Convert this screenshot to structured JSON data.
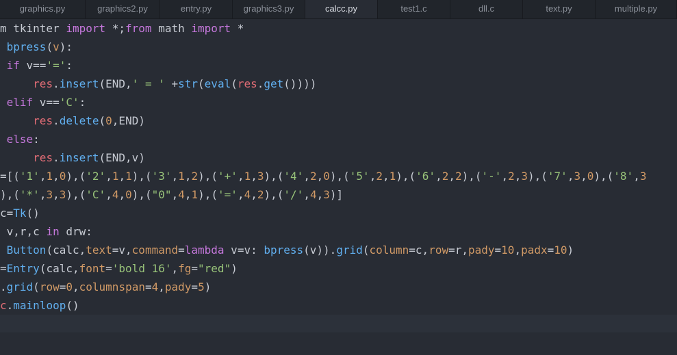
{
  "tabs": [
    {
      "label": "graphics.py",
      "active": false
    },
    {
      "label": "graphics2.py",
      "active": false
    },
    {
      "label": "entry.py",
      "active": false
    },
    {
      "label": "graphics3.py",
      "active": false
    },
    {
      "label": "calcc.py",
      "active": true
    },
    {
      "label": "test1.c",
      "active": false
    },
    {
      "label": "dll.c",
      "active": false
    },
    {
      "label": "text.py",
      "active": false
    },
    {
      "label": "multiple.py",
      "active": false
    }
  ],
  "colors": {
    "background": "#282c34",
    "keyword": "#c678dd",
    "function": "#61afef",
    "string": "#98c379",
    "number": "#d19a66",
    "variable": "#e06c75",
    "plain": "#c8ccd4"
  },
  "code": [
    [
      [
        "m tkinter ",
        "pl"
      ],
      [
        "import",
        "kw"
      ],
      [
        " *;",
        "pl"
      ],
      [
        "from",
        "kw"
      ],
      [
        " math ",
        "pl"
      ],
      [
        "import",
        "kw"
      ],
      [
        " *",
        "pl"
      ]
    ],
    [
      [
        " ",
        "pl"
      ],
      [
        "bpress",
        "fn"
      ],
      [
        "(",
        "pl"
      ],
      [
        "v",
        "num"
      ],
      [
        "):",
        "pl"
      ]
    ],
    [
      [
        " ",
        "pl"
      ],
      [
        "if",
        "kw"
      ],
      [
        " v==",
        "pl"
      ],
      [
        "'='",
        "str"
      ],
      [
        ":",
        "pl"
      ]
    ],
    [
      [
        "     ",
        "pl"
      ],
      [
        "res",
        "var"
      ],
      [
        ".",
        "pl"
      ],
      [
        "insert",
        "fn"
      ],
      [
        "(END,",
        "pl"
      ],
      [
        "' = '",
        "str"
      ],
      [
        " +",
        "pl"
      ],
      [
        "str",
        "fn"
      ],
      [
        "(",
        "pl"
      ],
      [
        "eval",
        "fn"
      ],
      [
        "(",
        "pl"
      ],
      [
        "res",
        "var"
      ],
      [
        ".",
        "pl"
      ],
      [
        "get",
        "fn"
      ],
      [
        "())))",
        "pl"
      ]
    ],
    [
      [
        " ",
        "pl"
      ],
      [
        "elif",
        "kw"
      ],
      [
        " v==",
        "pl"
      ],
      [
        "'C'",
        "str"
      ],
      [
        ":",
        "pl"
      ]
    ],
    [
      [
        "     ",
        "pl"
      ],
      [
        "res",
        "var"
      ],
      [
        ".",
        "pl"
      ],
      [
        "delete",
        "fn"
      ],
      [
        "(",
        "pl"
      ],
      [
        "0",
        "num"
      ],
      [
        ",END)",
        "pl"
      ]
    ],
    [
      [
        " ",
        "pl"
      ],
      [
        "else",
        "kw"
      ],
      [
        ":",
        "pl"
      ]
    ],
    [
      [
        "     ",
        "pl"
      ],
      [
        "res",
        "var"
      ],
      [
        ".",
        "pl"
      ],
      [
        "insert",
        "fn"
      ],
      [
        "(END,v)",
        "pl"
      ]
    ],
    [
      [
        "=[(",
        "pl"
      ],
      [
        "'1'",
        "str"
      ],
      [
        ",",
        "pl"
      ],
      [
        "1",
        "num"
      ],
      [
        ",",
        "pl"
      ],
      [
        "0",
        "num"
      ],
      [
        "),(",
        "pl"
      ],
      [
        "'2'",
        "str"
      ],
      [
        ",",
        "pl"
      ],
      [
        "1",
        "num"
      ],
      [
        ",",
        "pl"
      ],
      [
        "1",
        "num"
      ],
      [
        "),(",
        "pl"
      ],
      [
        "'3'",
        "str"
      ],
      [
        ",",
        "pl"
      ],
      [
        "1",
        "num"
      ],
      [
        ",",
        "pl"
      ],
      [
        "2",
        "num"
      ],
      [
        "),(",
        "pl"
      ],
      [
        "'+'",
        "str"
      ],
      [
        ",",
        "pl"
      ],
      [
        "1",
        "num"
      ],
      [
        ",",
        "pl"
      ],
      [
        "3",
        "num"
      ],
      [
        "),(",
        "pl"
      ],
      [
        "'4'",
        "str"
      ],
      [
        ",",
        "pl"
      ],
      [
        "2",
        "num"
      ],
      [
        ",",
        "pl"
      ],
      [
        "0",
        "num"
      ],
      [
        "),(",
        "pl"
      ],
      [
        "'5'",
        "str"
      ],
      [
        ",",
        "pl"
      ],
      [
        "2",
        "num"
      ],
      [
        ",",
        "pl"
      ],
      [
        "1",
        "num"
      ],
      [
        "),(",
        "pl"
      ],
      [
        "'6'",
        "str"
      ],
      [
        ",",
        "pl"
      ],
      [
        "2",
        "num"
      ],
      [
        ",",
        "pl"
      ],
      [
        "2",
        "num"
      ],
      [
        "),(",
        "pl"
      ],
      [
        "'-'",
        "str"
      ],
      [
        ",",
        "pl"
      ],
      [
        "2",
        "num"
      ],
      [
        ",",
        "pl"
      ],
      [
        "3",
        "num"
      ],
      [
        "),(",
        "pl"
      ],
      [
        "'7'",
        "str"
      ],
      [
        ",",
        "pl"
      ],
      [
        "3",
        "num"
      ],
      [
        ",",
        "pl"
      ],
      [
        "0",
        "num"
      ],
      [
        "),(",
        "pl"
      ],
      [
        "'8'",
        "str"
      ],
      [
        ",",
        "pl"
      ],
      [
        "3",
        "num"
      ]
    ],
    [
      [
        "),(",
        "pl"
      ],
      [
        "'*'",
        "str"
      ],
      [
        ",",
        "pl"
      ],
      [
        "3",
        "num"
      ],
      [
        ",",
        "pl"
      ],
      [
        "3",
        "num"
      ],
      [
        "),(",
        "pl"
      ],
      [
        "'C'",
        "str"
      ],
      [
        ",",
        "pl"
      ],
      [
        "4",
        "num"
      ],
      [
        ",",
        "pl"
      ],
      [
        "0",
        "num"
      ],
      [
        "),(",
        "pl"
      ],
      [
        "\"0\"",
        "str"
      ],
      [
        ",",
        "pl"
      ],
      [
        "4",
        "num"
      ],
      [
        ",",
        "pl"
      ],
      [
        "1",
        "num"
      ],
      [
        "),(",
        "pl"
      ],
      [
        "'='",
        "str"
      ],
      [
        ",",
        "pl"
      ],
      [
        "4",
        "num"
      ],
      [
        ",",
        "pl"
      ],
      [
        "2",
        "num"
      ],
      [
        "),(",
        "pl"
      ],
      [
        "'/'",
        "str"
      ],
      [
        ",",
        "pl"
      ],
      [
        "4",
        "num"
      ],
      [
        ",",
        "pl"
      ],
      [
        "3",
        "num"
      ],
      [
        ")]",
        "pl"
      ]
    ],
    [
      [
        "c=",
        "pl"
      ],
      [
        "Tk",
        "fn"
      ],
      [
        "()",
        "pl"
      ]
    ],
    [
      [
        " v,r,c ",
        "pl"
      ],
      [
        "in",
        "kw"
      ],
      [
        " drw:",
        "pl"
      ]
    ],
    [
      [
        " ",
        "pl"
      ],
      [
        "Button",
        "fn"
      ],
      [
        "(calc,",
        "pl"
      ],
      [
        "text",
        "num"
      ],
      [
        "=v,",
        "pl"
      ],
      [
        "command",
        "num"
      ],
      [
        "=",
        "pl"
      ],
      [
        "lambda",
        "kw"
      ],
      [
        " v=v: ",
        "pl"
      ],
      [
        "bpress",
        "fn"
      ],
      [
        "(v)).",
        "pl"
      ],
      [
        "grid",
        "fn"
      ],
      [
        "(",
        "pl"
      ],
      [
        "column",
        "num"
      ],
      [
        "=c,",
        "pl"
      ],
      [
        "row",
        "num"
      ],
      [
        "=r,",
        "pl"
      ],
      [
        "pady",
        "num"
      ],
      [
        "=",
        "pl"
      ],
      [
        "10",
        "num"
      ],
      [
        ",",
        "pl"
      ],
      [
        "padx",
        "num"
      ],
      [
        "=",
        "pl"
      ],
      [
        "10",
        "num"
      ],
      [
        ")",
        "pl"
      ]
    ],
    [
      [
        "=",
        "pl"
      ],
      [
        "Entry",
        "fn"
      ],
      [
        "(calc,",
        "pl"
      ],
      [
        "font",
        "num"
      ],
      [
        "=",
        "pl"
      ],
      [
        "'bold 16'",
        "str"
      ],
      [
        ",",
        "pl"
      ],
      [
        "fg",
        "num"
      ],
      [
        "=",
        "pl"
      ],
      [
        "\"red\"",
        "str"
      ],
      [
        ")",
        "pl"
      ]
    ],
    [
      [
        ".",
        "pl"
      ],
      [
        "grid",
        "fn"
      ],
      [
        "(",
        "pl"
      ],
      [
        "row",
        "num"
      ],
      [
        "=",
        "pl"
      ],
      [
        "0",
        "num"
      ],
      [
        ",",
        "pl"
      ],
      [
        "columnspan",
        "num"
      ],
      [
        "=",
        "pl"
      ],
      [
        "4",
        "num"
      ],
      [
        ",",
        "pl"
      ],
      [
        "pady",
        "num"
      ],
      [
        "=",
        "pl"
      ],
      [
        "5",
        "num"
      ],
      [
        ")",
        "pl"
      ]
    ],
    [
      [
        "c",
        "var"
      ],
      [
        ".",
        "pl"
      ],
      [
        "mainloop",
        "fn"
      ],
      [
        "()",
        "pl"
      ]
    ],
    [
      [
        "",
        "pl"
      ]
    ]
  ]
}
